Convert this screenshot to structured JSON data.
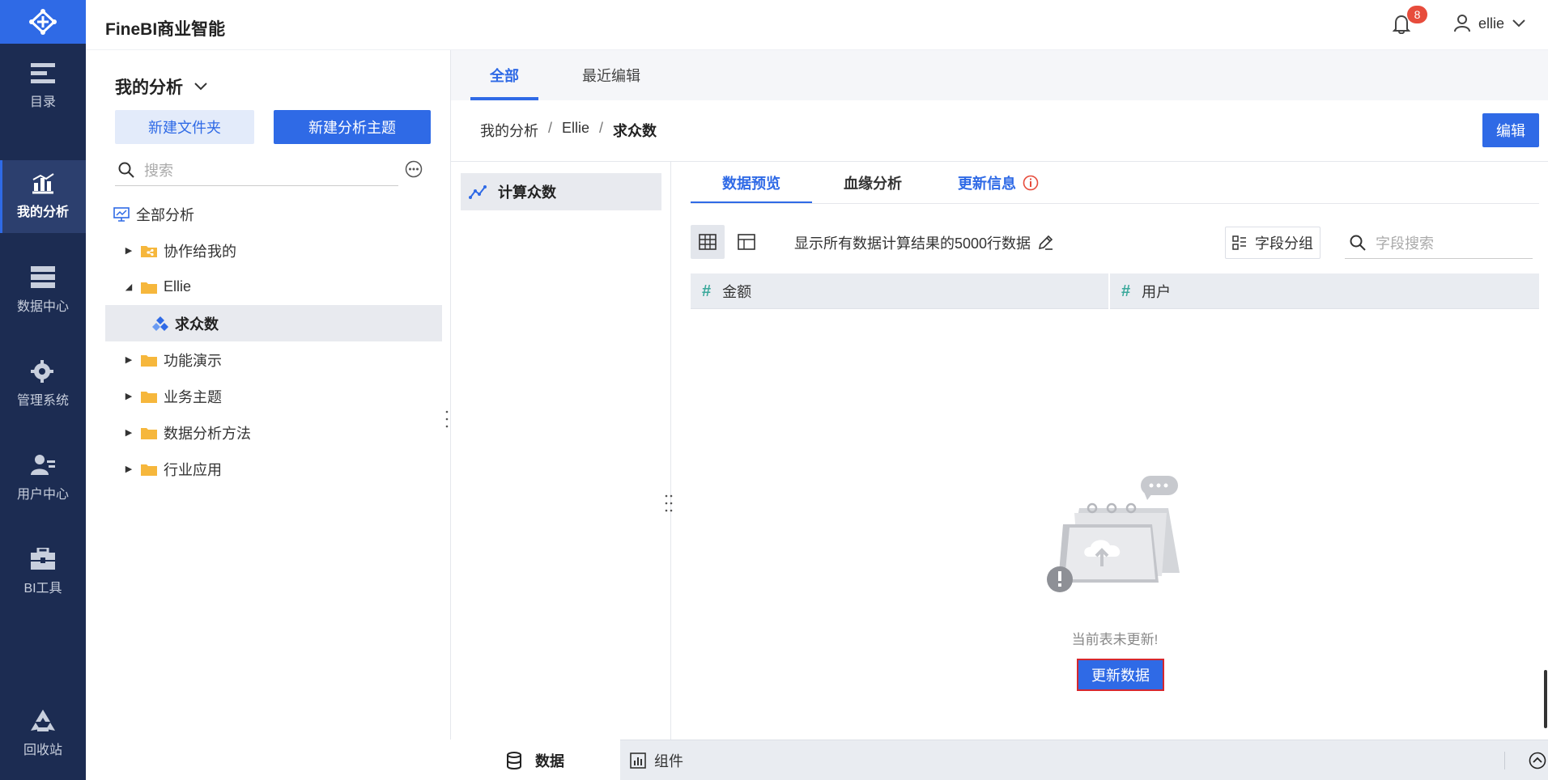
{
  "app": {
    "title": "FineBI商业智能"
  },
  "header": {
    "notification_count": "8",
    "username": "ellie"
  },
  "nav": {
    "items": [
      {
        "label": "目录",
        "icon": "catalog-icon"
      },
      {
        "label": "我的分析",
        "icon": "analysis-icon",
        "active": true
      },
      {
        "label": "数据中心",
        "icon": "data-center-icon"
      },
      {
        "label": "管理系统",
        "icon": "settings-gear-icon"
      },
      {
        "label": "用户中心",
        "icon": "user-center-icon"
      },
      {
        "label": "BI工具",
        "icon": "toolbox-icon"
      },
      {
        "label": "回收站",
        "icon": "recycle-icon"
      }
    ]
  },
  "left_panel": {
    "title": "我的分析",
    "new_folder": "新建文件夹",
    "new_subject": "新建分析主题",
    "search_placeholder": "搜索",
    "tree": {
      "all": "全部分析",
      "shared": "协作给我的",
      "ellie": "Ellie",
      "current": "求众数",
      "demo": "功能演示",
      "business": "业务主题",
      "methods": "数据分析方法",
      "industry": "行业应用"
    }
  },
  "main": {
    "tabs": {
      "all": "全部",
      "recent": "最近编辑"
    },
    "breadcrumb": {
      "root": "我的分析",
      "folder": "Ellie",
      "current": "求众数",
      "sep": "/"
    },
    "edit_button": "编辑",
    "calc_item": "计算众数",
    "content_tabs": {
      "preview": "数据预览",
      "lineage": "血缘分析",
      "update_info": "更新信息"
    },
    "toolbar_text": "显示所有数据计算结果的5000行数据",
    "field_group": "字段分组",
    "field_search_placeholder": "字段搜索",
    "columns": [
      {
        "type_icon": "#",
        "name": "金额"
      },
      {
        "type_icon": "#",
        "name": "用户"
      }
    ],
    "empty_text": "当前表未更新!",
    "update_button": "更新数据"
  },
  "bottom": {
    "data_tab": "数据",
    "component_tab": "组件"
  },
  "colors": {
    "primary": "#2f6ae6",
    "nav_bg": "#1c2c52",
    "badge": "#e74c3c",
    "field_number": "#3aa89b",
    "highlight_border": "#d6272e"
  }
}
